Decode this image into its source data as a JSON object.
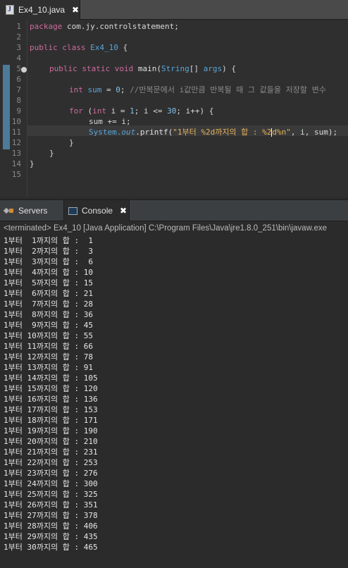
{
  "editor": {
    "tab_label": "Ex4_10.java",
    "tab_close": "✖",
    "line_numbers": [
      "1",
      "2",
      "3",
      "4",
      "5",
      "6",
      "7",
      "8",
      "9",
      "10",
      "11",
      "12",
      "13",
      "14",
      "15"
    ],
    "code": {
      "l1_kw": "package",
      "l1_rest": " com.jy.controlstatement;",
      "l3_kw1": "public",
      "l3_kw2": " class",
      "l3_cls": " Ex4_10",
      "l3_rest": " {",
      "l5_kw": "public static void",
      "l5_fn": " main(",
      "l5_ty": "String",
      "l5_mid": "[] ",
      "l5_arg": "args",
      "l5_rest": ") {",
      "l7_kw": "int",
      "l7_var": " sum",
      "l7_eq": " = ",
      "l7_num": "0",
      "l7_semi": "; ",
      "l7_comment": "//반복문에서 i값만큼 반복될 때 그 값들을 저장할 변수",
      "l9_kw": "for",
      "l9_a": " (",
      "l9_kw2": "int",
      "l9_b": " i = ",
      "l9_n1": "1",
      "l9_c": "; i <= ",
      "l9_n2": "30",
      "l9_d": "; i++) {",
      "l10": "sum += i;",
      "l11_sys": "System.",
      "l11_out": "out",
      "l11_fn": ".printf(",
      "l11_str1": "\"1부터 %2d까지의 합 : %2",
      "l11_str2": "d%n\"",
      "l11_rest": ", i, sum);",
      "l12": "}",
      "l13": "}",
      "l14": "}"
    }
  },
  "panel": {
    "tab_servers": "Servers",
    "tab_console": "Console",
    "tab_close": "✖",
    "terminated": "<terminated> Ex4_10 [Java Application] C:\\Program Files\\Java\\jre1.8.0_251\\bin\\javaw.exe",
    "output": [
      "1부터  1까지의 합 :  1",
      "1부터  2까지의 합 :  3",
      "1부터  3까지의 합 :  6",
      "1부터  4까지의 합 : 10",
      "1부터  5까지의 합 : 15",
      "1부터  6까지의 합 : 21",
      "1부터  7까지의 합 : 28",
      "1부터  8까지의 합 : 36",
      "1부터  9까지의 합 : 45",
      "1부터 10까지의 합 : 55",
      "1부터 11까지의 합 : 66",
      "1부터 12까지의 합 : 78",
      "1부터 13까지의 합 : 91",
      "1부터 14까지의 합 : 105",
      "1부터 15까지의 합 : 120",
      "1부터 16까지의 합 : 136",
      "1부터 17까지의 합 : 153",
      "1부터 18까지의 합 : 171",
      "1부터 19까지의 합 : 190",
      "1부터 20까지의 합 : 210",
      "1부터 21까지의 합 : 231",
      "1부터 22까지의 합 : 253",
      "1부터 23까지의 합 : 276",
      "1부터 24까지의 합 : 300",
      "1부터 25까지의 합 : 325",
      "1부터 26까지의 합 : 351",
      "1부터 27까지의 합 : 378",
      "1부터 28까지의 합 : 406",
      "1부터 29까지의 합 : 435",
      "1부터 30까지의 합 : 465"
    ]
  }
}
